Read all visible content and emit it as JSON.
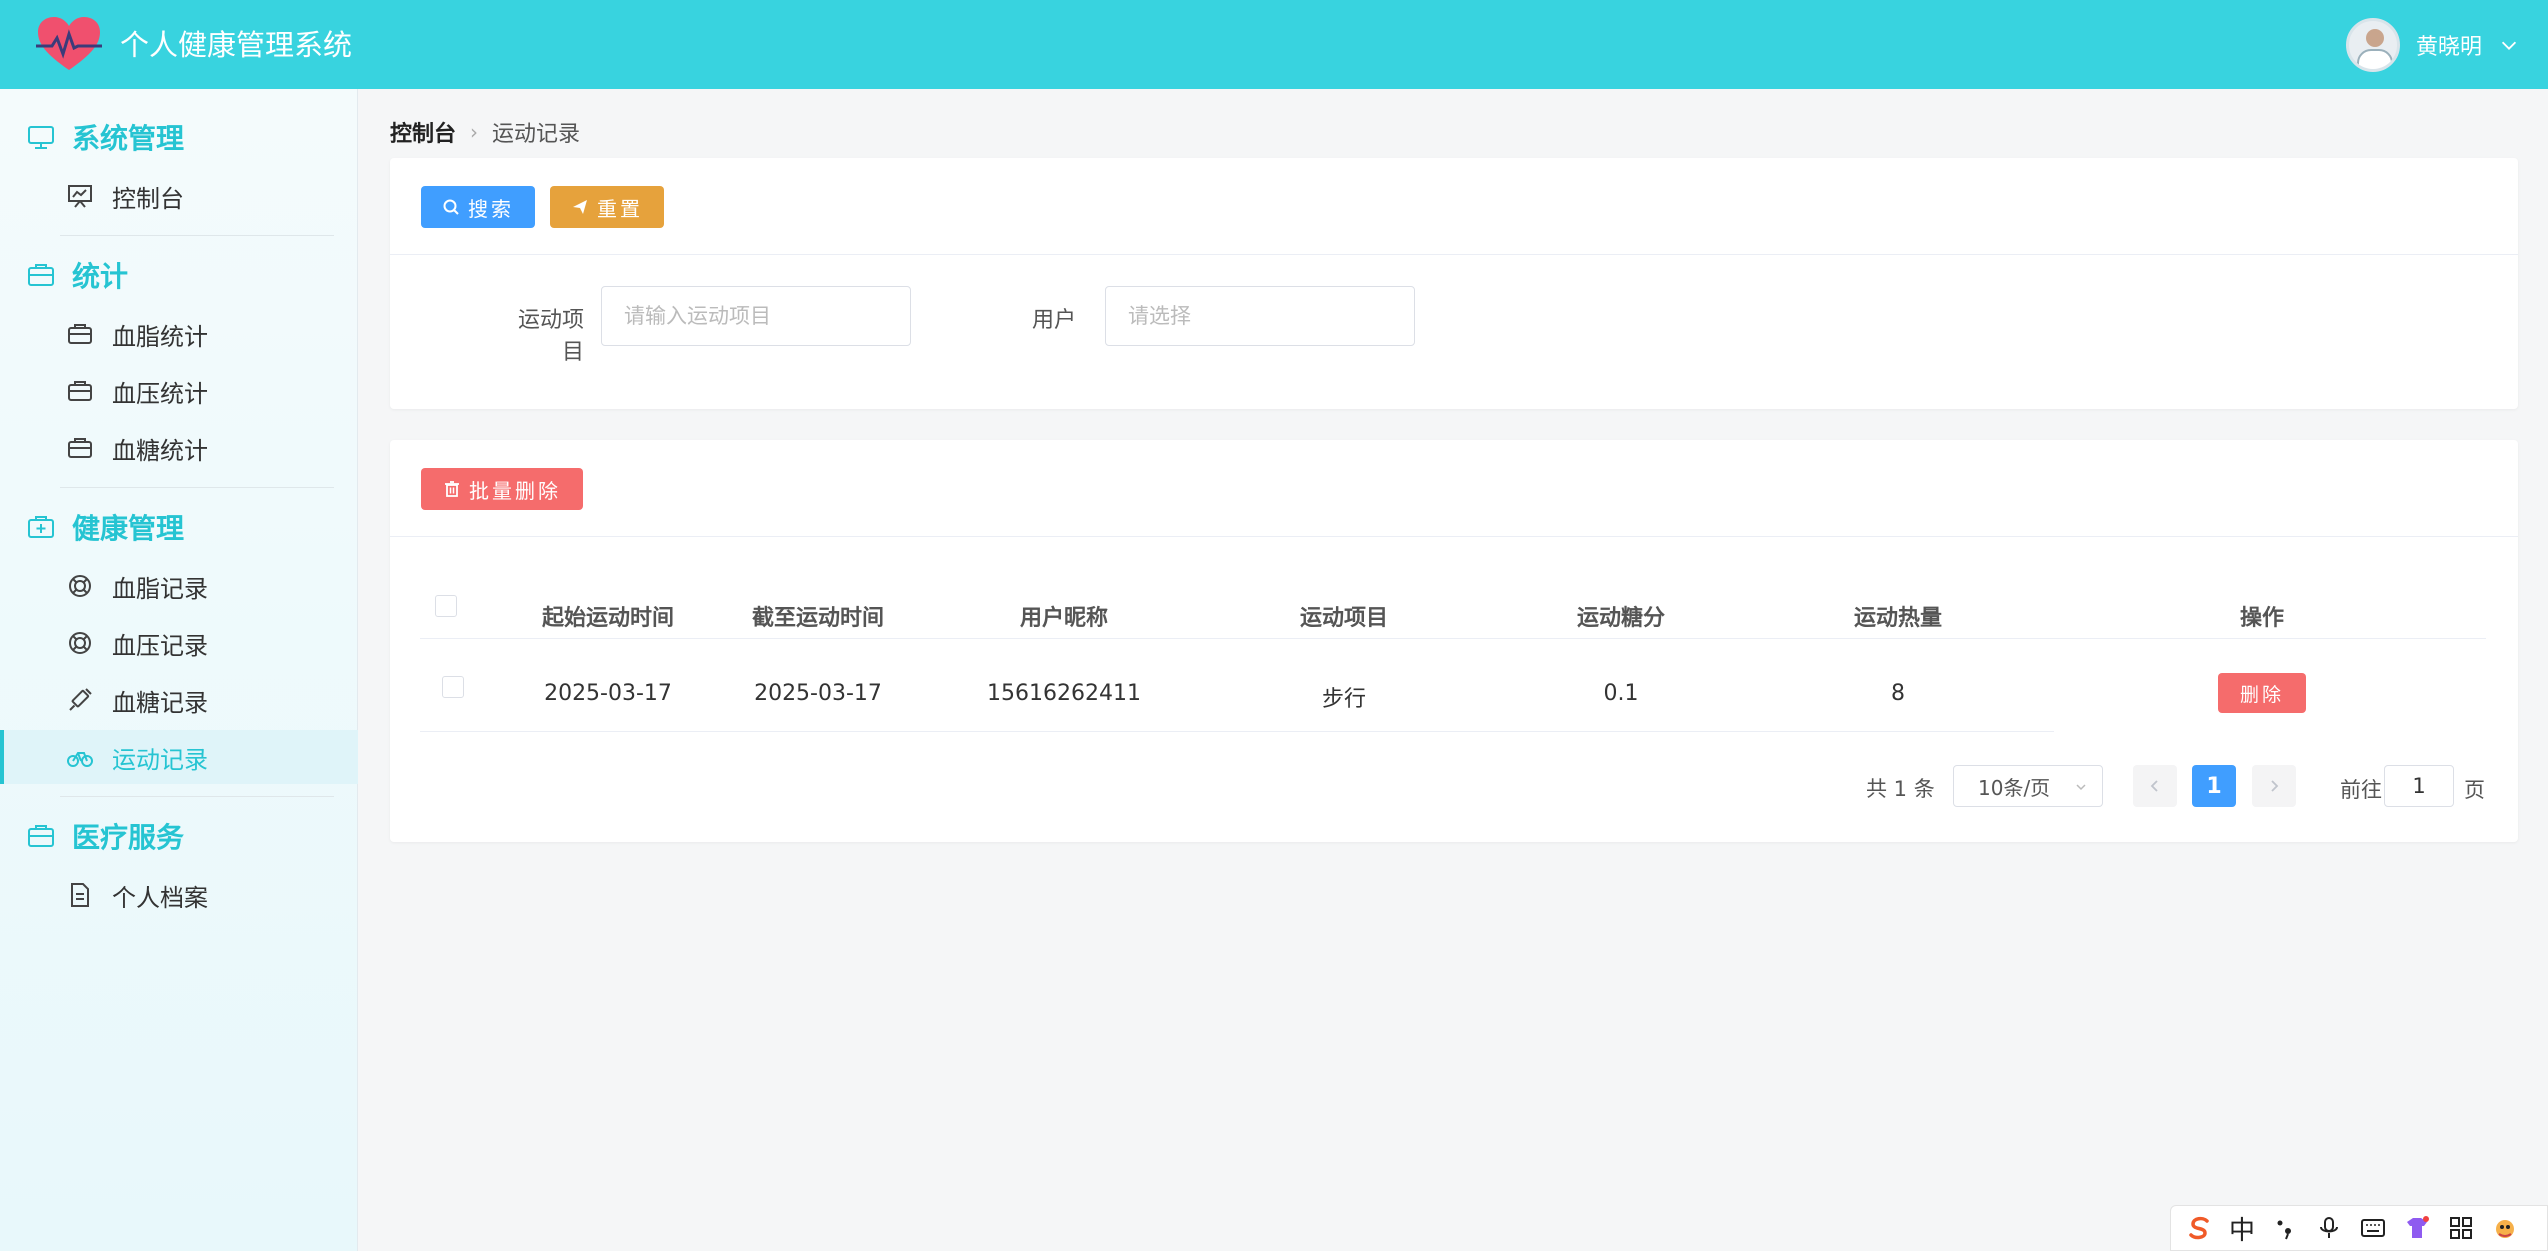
{
  "header": {
    "app_title": "个人健康管理系统",
    "user_name": "黄晓明",
    "brand_color": "#38d3df"
  },
  "sidebar": {
    "groups": [
      {
        "title": "系统管理",
        "icon": "monitor-icon",
        "items": [
          {
            "label": "控制台",
            "icon": "presentation-icon"
          }
        ]
      },
      {
        "title": "统计",
        "icon": "briefcase-icon",
        "items": [
          {
            "label": "血脂统计",
            "icon": "briefcase-icon"
          },
          {
            "label": "血压统计",
            "icon": "briefcase-icon"
          },
          {
            "label": "血糖统计",
            "icon": "briefcase-icon"
          }
        ]
      },
      {
        "title": "健康管理",
        "icon": "medical-kit-icon",
        "items": [
          {
            "label": "血脂记录",
            "icon": "lifebuoy-icon"
          },
          {
            "label": "血压记录",
            "icon": "lifebuoy-icon"
          },
          {
            "label": "血糖记录",
            "icon": "syringe-icon"
          },
          {
            "label": "运动记录",
            "icon": "bicycle-icon",
            "active": true
          }
        ]
      },
      {
        "title": "医疗服务",
        "icon": "briefcase-icon",
        "items": [
          {
            "label": "个人档案",
            "icon": "document-icon"
          }
        ]
      }
    ]
  },
  "breadcrumb": {
    "home": "控制台",
    "separator": "›",
    "current": "运动记录"
  },
  "toolbar": {
    "search_label": "搜索",
    "reset_label": "重置"
  },
  "filters": {
    "exercise_label": "运动项目",
    "exercise_placeholder": "请输入运动项目",
    "exercise_value": "",
    "user_label": "用户",
    "user_placeholder": "请选择",
    "user_value": ""
  },
  "actions": {
    "batch_delete_label": "批量删除"
  },
  "table": {
    "columns": [
      "起始运动时间",
      "截至运动时间",
      "用户昵称",
      "运动项目",
      "运动糖分",
      "运动热量",
      "操作"
    ],
    "rows": [
      {
        "start": "2025-03-17",
        "end": "2025-03-17",
        "nickname": "15616262411",
        "exercise": "步行",
        "sugar": "0.1",
        "calories": "8",
        "action": "删除"
      }
    ]
  },
  "pagination": {
    "total_text": "共 1 条",
    "page_size": "10条/页",
    "current_page": "1",
    "goto_prefix": "前往",
    "goto_value": "1",
    "goto_suffix": "页"
  },
  "ime_bar": {
    "mode": "中"
  }
}
